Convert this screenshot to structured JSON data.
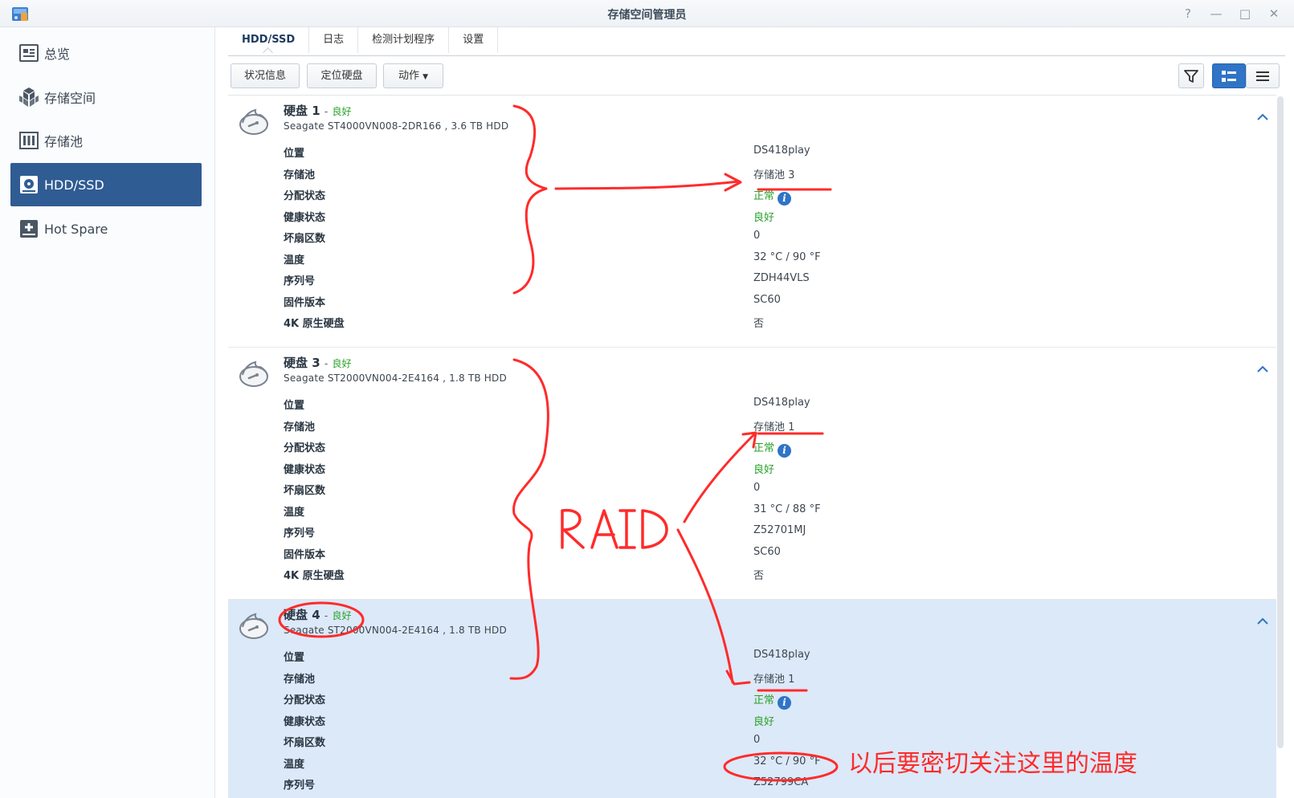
{
  "window": {
    "title": "存储空间管理员",
    "help": "?",
    "minimize": "—",
    "maximize": "□",
    "close": "✕"
  },
  "sidebar": {
    "items": [
      {
        "label": "总览",
        "icon": "overview-icon"
      },
      {
        "label": "存储空间",
        "icon": "storage-space-icon"
      },
      {
        "label": "存储池",
        "icon": "storage-pool-icon"
      },
      {
        "label": "HDD/SSD",
        "icon": "hdd-icon",
        "active": true
      },
      {
        "label": "Hot Spare",
        "icon": "hot-spare-icon"
      }
    ]
  },
  "tabs": [
    "HDD/SSD",
    "日志",
    "检测计划程序",
    "设置"
  ],
  "toolbar": {
    "status_info": "状况信息",
    "locate_disk": "定位硬盘",
    "action": "动作"
  },
  "fields": [
    "位置",
    "存储池",
    "分配状态",
    "健康状态",
    "坏扇区数",
    "温度",
    "序列号",
    "固件版本",
    "4K 原生硬盘"
  ],
  "disks": [
    {
      "name": "硬盘 1",
      "dash": "-",
      "status": "良好",
      "model": "Seagate ST4000VN008-2DR166 , 3.6 TB HDD",
      "values": [
        "DS418play",
        "存储池 3",
        "正常",
        "良好",
        "0",
        "32 °C / 90 °F",
        "ZDH44VLS",
        "SC60",
        "否"
      ]
    },
    {
      "name": "硬盘 3",
      "dash": "-",
      "status": "良好",
      "model": "Seagate ST2000VN004-2E4164 , 1.8 TB HDD",
      "values": [
        "DS418play",
        "存储池 1",
        "正常",
        "良好",
        "0",
        "31 °C / 88 °F",
        "Z52701MJ",
        "SC60",
        "否"
      ]
    },
    {
      "name": "硬盘 4",
      "dash": "-",
      "status": "良好",
      "model": "Seagate ST2000VN004-2E4164 , 1.8 TB HDD",
      "values": [
        "DS418play",
        "存储池 1",
        "正常",
        "良好",
        "0",
        "32 °C / 90 °F",
        "Z52799CA"
      ]
    }
  ],
  "annotations": {
    "raid": "RAID",
    "note": "以后要密切关注这里的温度",
    "color": "#ff2b2b"
  },
  "colors": {
    "accent": "#2f5c93",
    "good": "#2aa02a",
    "selected_row": "#dce9f8"
  }
}
